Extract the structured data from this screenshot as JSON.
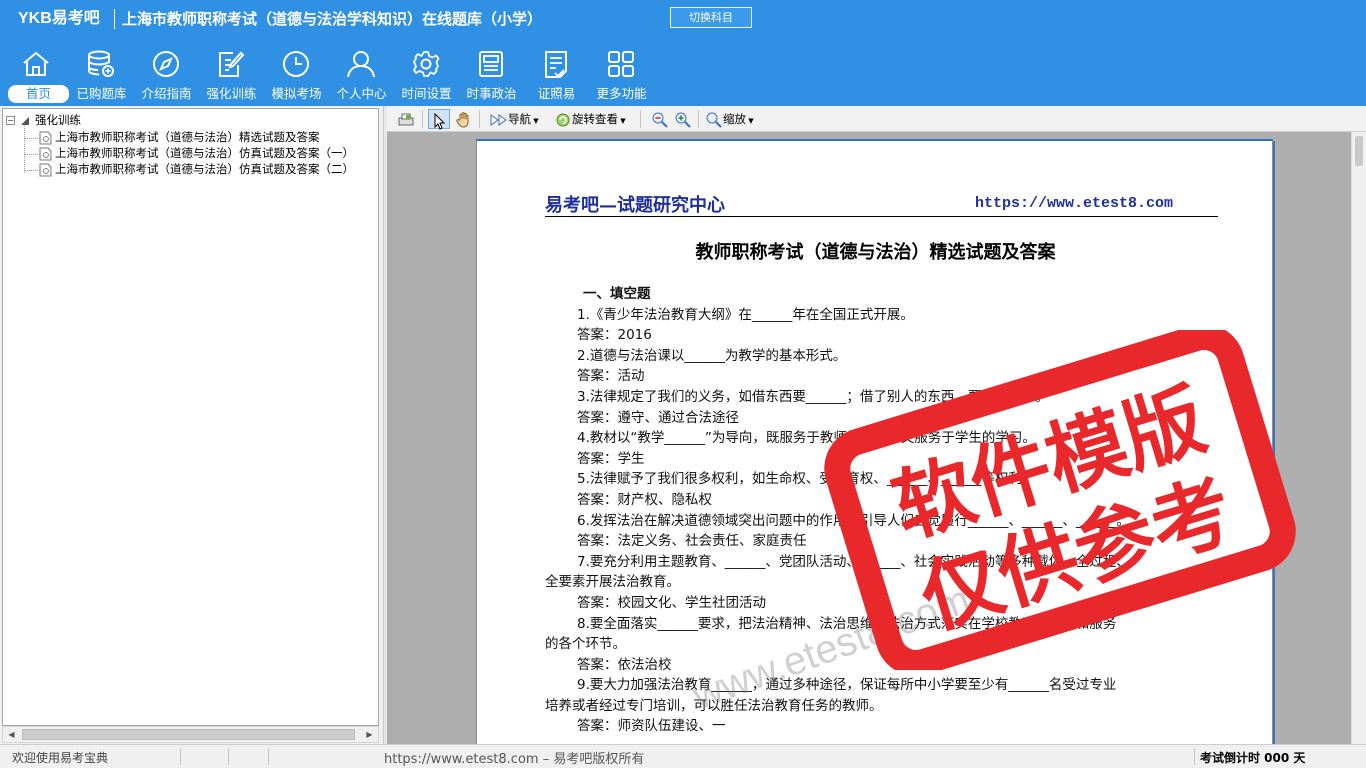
{
  "header": {
    "brand": "YKB易考吧",
    "title": "上海市教师职称考试（道德与法治学科知识）在线题库（小学）",
    "switch_label": "切换科目"
  },
  "nav": {
    "items": [
      {
        "label": "首页",
        "icon": "home-icon"
      },
      {
        "label": "已购题库",
        "icon": "database-icon"
      },
      {
        "label": "介绍指南",
        "icon": "compass-icon"
      },
      {
        "label": "强化训练",
        "icon": "edit-icon"
      },
      {
        "label": "模拟考场",
        "icon": "clock-icon"
      },
      {
        "label": "个人中心",
        "icon": "user-icon"
      },
      {
        "label": "时间设置",
        "icon": "gear-icon"
      },
      {
        "label": "时事政治",
        "icon": "news-icon"
      },
      {
        "label": "证照易",
        "icon": "checklist-icon"
      },
      {
        "label": "更多功能",
        "icon": "grid-icon"
      }
    ],
    "active_index": 0
  },
  "tree": {
    "root": "强化训练",
    "items": [
      "上海市教师职称考试（道德与法治）精选试题及答案",
      "上海市教师职称考试（道德与法治）仿真试题及答案（一）",
      "上海市教师职称考试（道德与法治）仿真试题及答案（二）"
    ]
  },
  "toolbar": {
    "nav_label": "导航",
    "rotate_label": "旋转查看",
    "zoom_label": "缩放"
  },
  "document": {
    "brand": "易考吧—试题研究中心",
    "url": "https://www.etest8.com",
    "title": "教师职称考试（道德与法治）精选试题及答案",
    "lines": [
      {
        "text": "一、填空题",
        "style": "h1"
      },
      {
        "text": "1.《青少年法治教育大纲》在______年在全国正式开展。",
        "style": "ind"
      },
      {
        "text": "答案：2016",
        "style": "ind"
      },
      {
        "text": "2.道德与法治课以______为教学的基本形式。",
        "style": "ind"
      },
      {
        "text": "答案：活动",
        "style": "ind"
      },
      {
        "text": "3.法律规定了我们的义务，如借东西要______；借了别人的东西，要______等。",
        "style": "ind"
      },
      {
        "text": "答案：遵守、通过合法途径",
        "style": "ind"
      },
      {
        "text": "4.教材以“教学______”为导向，既服务于教师的教学，又服务于学生的学习。",
        "style": "ind"
      },
      {
        "text": "答案：学生",
        "style": "ind"
      },
      {
        "text": "5.法律赋予了我们很多权利，如生命权、受教育权、______、______等权利。",
        "style": "ind"
      },
      {
        "text": "答案：财产权、隐私权",
        "style": "ind"
      },
      {
        "text": "6.发挥法治在解决道德领域突出问题中的作用，引导人们自觉履行______、______、______。",
        "style": "ind"
      },
      {
        "text": "答案：法定义务、社会责任、家庭责任",
        "style": "ind"
      },
      {
        "text": "7.要充分利用主题教育、______、党团队活动、______、社会实践活动等多种载体，全过程、",
        "style": "ind"
      },
      {
        "text": "全要素开展法治教育。",
        "style": "plain"
      },
      {
        "text": "答案：校园文化、学生社团活动",
        "style": "ind"
      },
      {
        "text": "8.要全面落实______要求，把法治精神、法治思维和法治方式落实在学校教育、管理和服务",
        "style": "ind"
      },
      {
        "text": "的各个环节。",
        "style": "plain"
      },
      {
        "text": "答案：依法治校",
        "style": "ind"
      },
      {
        "text": "9.要大力加强法治教育______，通过多种途径，保证每所中小学要至少有______名受过专业",
        "style": "ind"
      },
      {
        "text": "培养或者经过专门培训，可以胜任法治教育任务的教师。",
        "style": "plain"
      },
      {
        "text": "答案：师资队伍建设、一",
        "style": "ind"
      }
    ],
    "stamp_line1": "软件模版",
    "stamp_line2": "仅供参考",
    "stamp_color": "#e8282b",
    "watermark": "www.etest8.com"
  },
  "status": {
    "welcome": "欢迎使用易考宝典",
    "copyright": "https://www.etest8.com – 易考吧版权所有",
    "countdown": "考试倒计时 000 天"
  },
  "colors": {
    "header_bg": "#2f90e4",
    "doc_blue": "#1f2f9c"
  }
}
